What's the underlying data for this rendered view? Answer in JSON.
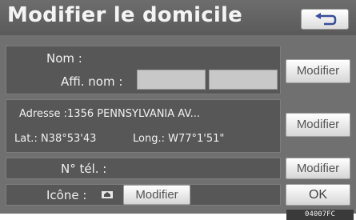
{
  "header": {
    "title": "Modifier le domicile"
  },
  "name_section": {
    "name_label": "Nom :",
    "display_name_label": "Affi. nom :",
    "modify_label": "Modifier"
  },
  "address_section": {
    "address_text": "Adresse :1356 PENNSYLVANIA AV...",
    "lat_text": "Lat.: N38°53'43",
    "long_text": "Long.: W77°1'51\"",
    "modify_label": "Modifier"
  },
  "phone_section": {
    "phone_label": "N° tél. :",
    "modify_label": "Modifier"
  },
  "icon_section": {
    "icon_label": "Icône :",
    "icon_name": "home-pin-icon",
    "modify_label": "Modifier"
  },
  "ok_label": "OK",
  "image_code": "04007FC"
}
